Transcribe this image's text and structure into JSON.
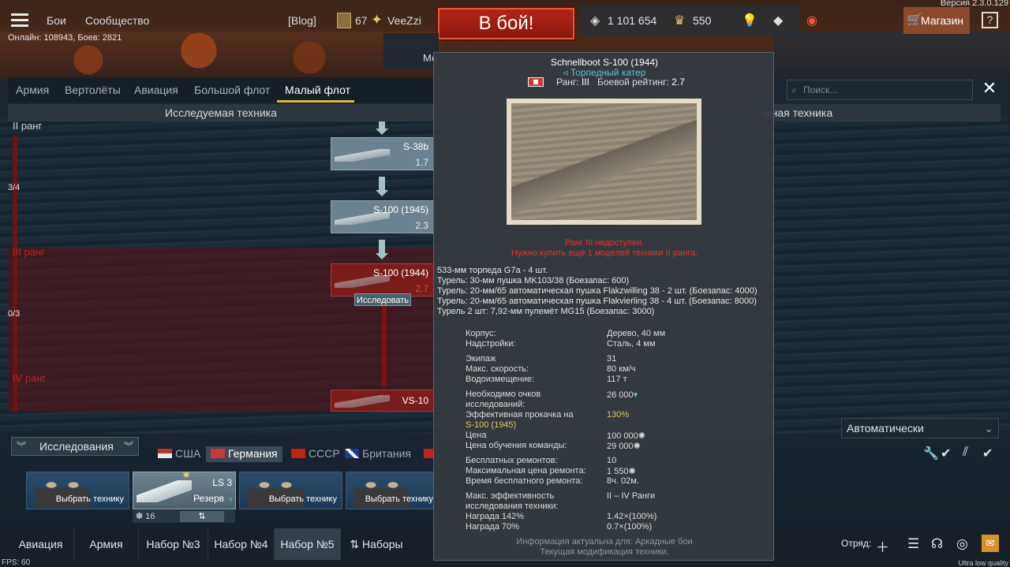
{
  "header": {
    "nav_battles": "Бои",
    "nav_community": "Сообщество",
    "blog": "[Blog]",
    "player_level": "67",
    "player_name": "VeeZzi",
    "online": "Онлайн: 108943, Боев: 2821",
    "version": "Версия 2.3.0.129",
    "battle_button": "В бой!",
    "silver": "1 101 654",
    "gold": "550",
    "shop": "Магазин",
    "help": "?"
  },
  "research": {
    "tabs": [
      {
        "label": "Армия"
      },
      {
        "label": "Вертолёты"
      },
      {
        "label": "Авиация"
      },
      {
        "label": "Большой флот"
      },
      {
        "label": "Малый флот"
      }
    ],
    "subheader_left": "Исследуемая техника",
    "subheader_right": "мная техника",
    "search_placeholder": "Поиск...",
    "ranks": [
      {
        "label": "II ранг",
        "progress": "3/4"
      },
      {
        "label": "III ранг",
        "progress": "0/3"
      },
      {
        "label": "IV ранг"
      }
    ],
    "cards": [
      {
        "name": "S-38b",
        "br": "1.7"
      },
      {
        "name": "S-100 (1945)",
        "br": "2.3"
      },
      {
        "name": "S-100 (1944)",
        "br": "2.7"
      },
      {
        "name": "VS-10",
        "br": ""
      }
    ],
    "hover_tooltip": "Исследовать",
    "tooltip_m": "Мо"
  },
  "crew": {
    "research_button": "Исследования",
    "nations": [
      {
        "label": "США"
      },
      {
        "label": "Германия"
      },
      {
        "label": "СССР"
      },
      {
        "label": "Британия"
      }
    ],
    "choose": "Выбрать технику",
    "boat_name": "LS 3",
    "boat_status": "Резерв",
    "boat_count": "16",
    "auto": "Автоматически"
  },
  "bottombar": {
    "tabs": [
      "Авиация",
      "Армия",
      "Набор №3",
      "Набор №4",
      "Набор №5",
      "Наборы"
    ],
    "squad": "Отряд:"
  },
  "fps": "FPS: 60",
  "quality": "Ultra low quality",
  "panel": {
    "title": "Schnellboot S-100 (1944)",
    "type": "◃ Торпедный катер",
    "rank_label": "Ранг:",
    "rank": "III",
    "br_label": "Боевой рейтинг:",
    "br": "2.7",
    "warn1": "Ранг III недоступен.",
    "warn2": "Нужно купить ещё 1 моделей техники II ранга.",
    "armament": [
      "533-мм торпеда G7a - 4 шт.",
      "Турель: 30-мм пушка MK103/38 (Боезапас: 600)",
      "Турель: 20-мм/65 автоматическая пушка Flakzwilling 38 - 2 шт. (Боезапас: 4000)",
      "Турель: 20-мм/65 автоматическая пушка Flakvierling 38 - 4 шт. (Боезапас: 8000)",
      "Турель 2 шт: 7,92-мм пулемёт MG15 (Боезапас: 3000)"
    ],
    "stats": [
      {
        "k": "Корпус:",
        "v": "Дерево, 40 мм"
      },
      {
        "k": "Надстройки:",
        "v": "Сталь, 4 мм"
      },
      {
        "k": "Экипаж",
        "v": "31"
      },
      {
        "k": "Макс. скорость:",
        "v": "80 км/ч"
      },
      {
        "k": "Водоизмещение:",
        "v": "117 т"
      },
      {
        "k": "Необходимо очков",
        "v": "26 000"
      },
      {
        "k": "исследований:",
        "v": ""
      },
      {
        "k": "Эффективная прокачка на",
        "v": "130%"
      },
      {
        "k": "S-100 (1945)",
        "v": ""
      },
      {
        "k": "Цена",
        "v": "100 000"
      },
      {
        "k": "Цена обучения команды:",
        "v": "29 000"
      },
      {
        "k": "Бесплатных ремонтов:",
        "v": "10"
      },
      {
        "k": "Максимальная цена ремонта:",
        "v": "1 550"
      },
      {
        "k": "Время бесплатного ремонта:",
        "v": "8ч. 02м."
      },
      {
        "k": "Макс. эффективность",
        "v": "II – IV Ранги"
      },
      {
        "k": "исследования техники:",
        "v": ""
      },
      {
        "k": "Награда 142%",
        "v": "1.42×(100%)"
      },
      {
        "k": "Награда 70%",
        "v": "0.7×(100%)"
      }
    ],
    "foot1": "Информация актуальна для: Аркадные бои",
    "foot2": "Текущая модификация техники."
  }
}
